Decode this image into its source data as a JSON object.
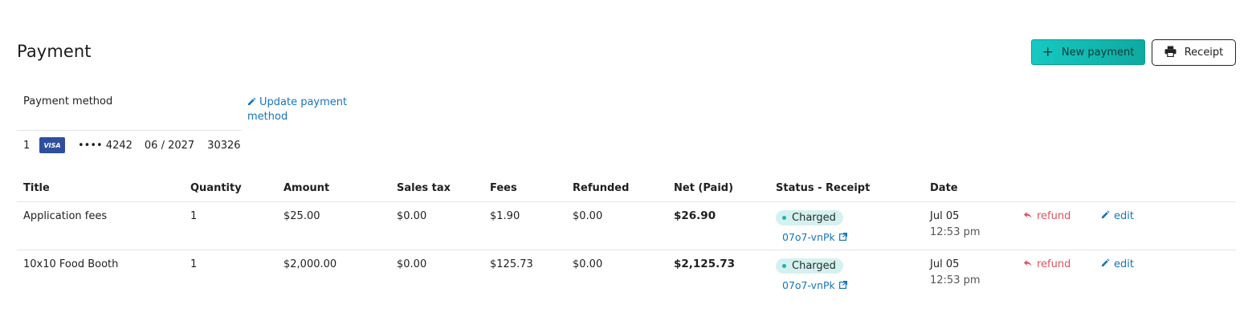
{
  "header": {
    "title": "Payment",
    "new_payment_label": "New payment",
    "receipt_label": "Receipt"
  },
  "payment_method": {
    "label": "Payment method",
    "update_label": "Update payment method",
    "card": {
      "index": "1",
      "brand": "VISA",
      "last4": "•••• 4242",
      "expiry": "06 / 2027",
      "zip": "30326"
    }
  },
  "table": {
    "columns": [
      "Title",
      "Quantity",
      "Amount",
      "Sales tax",
      "Fees",
      "Refunded",
      "Net (Paid)",
      "Status - Receipt",
      "Date"
    ],
    "rows": [
      {
        "title": "Application fees",
        "quantity": "1",
        "amount": "$25.00",
        "sales_tax": "$0.00",
        "fees": "$1.90",
        "refunded": "$0.00",
        "net": "$26.90",
        "status": "Charged",
        "receipt_id": "07o7-vnPk",
        "date": "Jul 05",
        "time": "12:53 pm",
        "refund_label": "refund",
        "edit_label": "edit"
      },
      {
        "title": "10x10 Food Booth",
        "quantity": "1",
        "amount": "$2,000.00",
        "sales_tax": "$0.00",
        "fees": "$125.73",
        "refunded": "$0.00",
        "net": "$2,125.73",
        "status": "Charged",
        "receipt_id": "07o7-vnPk",
        "date": "Jul 05",
        "time": "12:53 pm",
        "refund_label": "refund",
        "edit_label": "edit"
      }
    ]
  },
  "colors": {
    "accent": "#14b8ae",
    "link": "#1674b8",
    "refund": "#e0525b",
    "visa": "#2f4f9e",
    "badge_bg": "#d5f1ef"
  },
  "icons": {
    "new_payment": "plus-icon",
    "receipt": "printer-icon",
    "update": "pencil-icon",
    "receipt_link": "external-link-icon",
    "refund": "reply-arrow-icon",
    "edit": "pencil-icon"
  }
}
